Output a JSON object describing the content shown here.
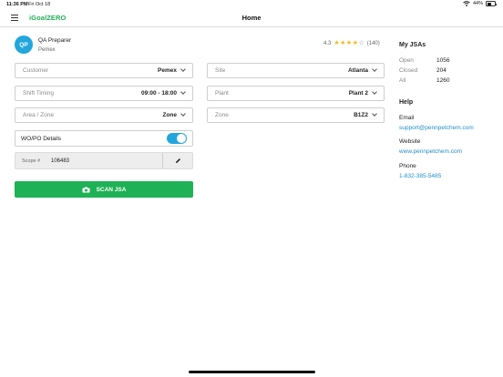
{
  "status_bar": {
    "time": "11:36 PM",
    "date": "Fri Oct 18",
    "battery": "44%"
  },
  "nav": {
    "brand": "iGoalZERO",
    "title": "Home"
  },
  "user": {
    "initials": "QP",
    "name": "QA Preparer",
    "company": "Pemex"
  },
  "rating": {
    "score": "4.3",
    "count": "(140)",
    "stars_filled": 4,
    "stars_total": 5,
    "star_color": "#f2b91a"
  },
  "form": {
    "customer": {
      "label": "Customer",
      "value": "Pemex"
    },
    "site": {
      "label": "Site",
      "value": "Atlanta"
    },
    "shift": {
      "label": "Shift Timing",
      "value": "09:00 - 18:00"
    },
    "plant": {
      "label": "Plant",
      "value": "Plant 2"
    },
    "area": {
      "label": "Area / Zone",
      "value": "Zone"
    },
    "zone": {
      "label": "Zone",
      "value": "B1Z2"
    },
    "wopo": {
      "label": "WO/PO Details",
      "enabled": true
    },
    "scope": {
      "label": "Scope #",
      "value": "106483"
    },
    "scan_label": "SCAN JSA"
  },
  "jsas": {
    "title": "My JSAs",
    "rows": [
      {
        "label": "Open",
        "value": "1056"
      },
      {
        "label": "Closed",
        "value": "204"
      },
      {
        "label": "All",
        "value": "1260"
      }
    ]
  },
  "help": {
    "title": "Help",
    "email_label": "Email",
    "email": "support@pennpetchem.com",
    "website_label": "Website",
    "website": "www.pennpetchem.com",
    "phone_label": "Phone",
    "phone": "1-832-385-5485"
  },
  "colors": {
    "accent_green": "#1fb155",
    "accent_blue": "#22a6dc",
    "link": "#1f8fc7"
  }
}
